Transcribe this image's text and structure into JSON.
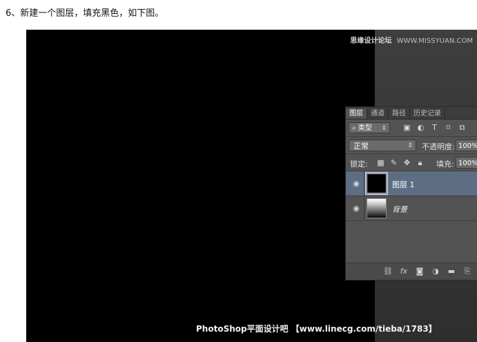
{
  "caption": "6、新建一个图层，填充黑色，如下图。",
  "watermarks": {
    "top_cn": "思缘设计论坛",
    "top_url": "WWW.MISSYUAN.COM",
    "bottom": "PhotoShop平面设计吧 【www.linecg.com/tieba/1783】"
  },
  "panel": {
    "tabs": [
      "图层",
      "通道",
      "路径",
      "历史记录"
    ],
    "kind_filter": "类型",
    "filter_icons": [
      "image-filter-icon",
      "adjustment-filter-icon",
      "type-filter-icon",
      "shape-filter-icon",
      "smart-object-filter-icon"
    ],
    "blend_mode": "正常",
    "opacity_label": "不透明度:",
    "opacity_value": "100%",
    "lock_label": "锁定:",
    "lock_icons": [
      "lock-transparent-icon",
      "lock-image-icon",
      "lock-position-icon",
      "lock-all-icon"
    ],
    "fill_label": "填充:",
    "fill_value": "100%",
    "layers": [
      {
        "name": "图层 1",
        "selected": true
      },
      {
        "name": "背景",
        "selected": false
      }
    ],
    "bottom_icons": [
      "link-icon",
      "fx-icon",
      "mask-icon",
      "adjustment-icon",
      "folder-icon",
      "new-layer-icon"
    ]
  },
  "colors": {
    "canvas": "#000000",
    "panel_bg": "#535353",
    "selection": "#5d6d83"
  }
}
